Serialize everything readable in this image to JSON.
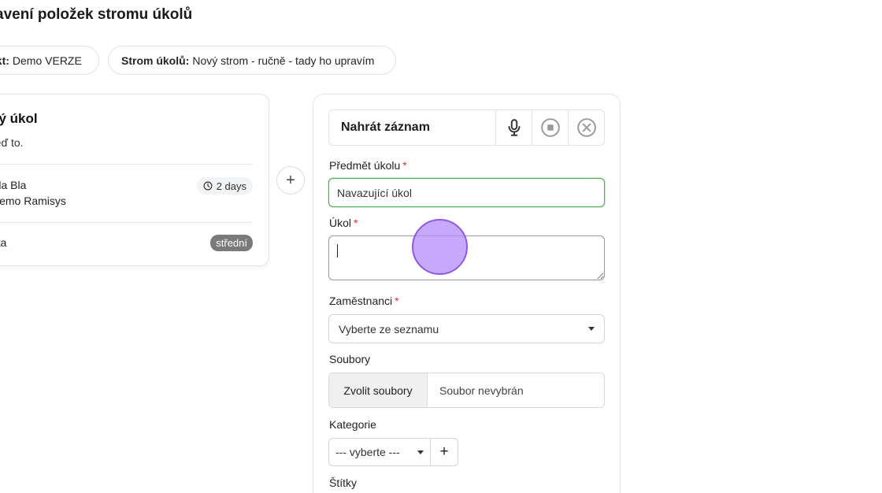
{
  "header": {
    "title": "avení položek stromu úkolů"
  },
  "pills": {
    "project_label": "ekt:",
    "project_value": "Demo VERZE",
    "tree_label": "Strom úkolů:",
    "tree_value": "Nový strom - ručně - tady ho upravím"
  },
  "left_card": {
    "title": "vý úkol",
    "description": "řeď to.",
    "line1": "Bla Bla",
    "line2": "Demo Ramisys",
    "days_badge": "2 days",
    "priority_label": "rita",
    "priority_badge": "střední"
  },
  "add_button": {
    "label": "+"
  },
  "form": {
    "record_label": "Nahrát záznam",
    "subject_label": "Předmět úkolu",
    "subject_value": "Navazující úkol",
    "task_label": "Úkol",
    "task_value": "",
    "employees_label": "Zaměstnanci",
    "employees_selected": "Vyberte ze seznamu",
    "files_label": "Soubory",
    "files_button": "Zvolit soubory",
    "files_status": "Soubor nevybrán",
    "category_label": "Kategorie",
    "category_selected": "--- vyberte ---",
    "category_add": "+",
    "tags_label": "Štítky",
    "required_mark": "*"
  },
  "colors": {
    "accent_green": "#4caf50",
    "required_red": "#d63333",
    "cursor_purple": "#b48cfa",
    "priority_badge_bg": "#7a7a7a"
  },
  "icons": {
    "mic": "microphone-icon",
    "stop": "stop-icon",
    "close": "close-icon",
    "clock": "clock-icon"
  }
}
